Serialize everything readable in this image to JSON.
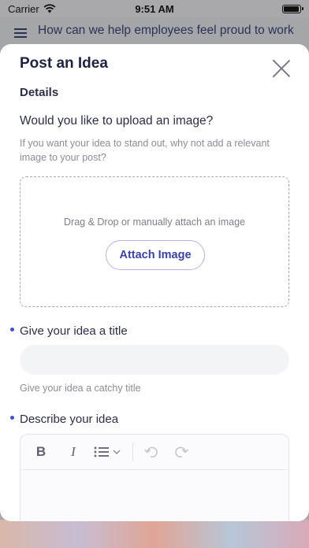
{
  "status_bar": {
    "carrier": "Carrier",
    "time": "9:51 AM",
    "battery_level": 1.0
  },
  "background": {
    "header_title": "How can we help employees feel proud to work here?"
  },
  "modal": {
    "title": "Post an Idea",
    "section": "Details",
    "upload": {
      "question": "Would you like to upload an image?",
      "help": "If you want your idea to stand out, why not add a relevant image to your post?",
      "dropzone_text": "Drag & Drop or manually attach an image",
      "button_label": "Attach Image"
    },
    "idea_title": {
      "label": "Give your idea a title",
      "value": "",
      "help": "Give your idea a catchy title"
    },
    "description": {
      "label": "Describe your idea",
      "toolbar": {
        "bold": "B",
        "italic": "I"
      }
    }
  },
  "colors": {
    "accent": "#4450bf",
    "title_text": "#1e2340"
  }
}
